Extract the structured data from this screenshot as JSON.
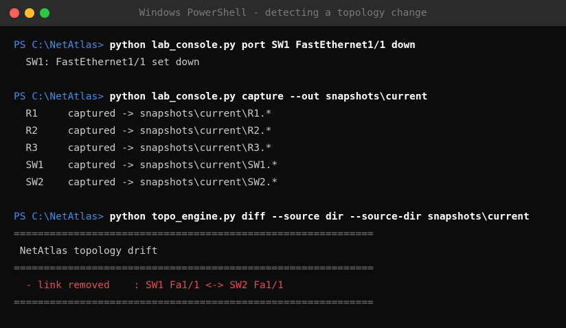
{
  "window": {
    "title": "Windows PowerShell - detecting a topology change",
    "controls": {
      "close_color": "#ff5f57",
      "minimize_color": "#febc2e",
      "maximize_color": "#28c840"
    }
  },
  "terminal": {
    "prompt": "PS C:\\NetAtlas>",
    "colors": {
      "prompt": "#3b8eea",
      "command": "#ffffff",
      "output": "#cccccc",
      "rule": "#767676",
      "removed": "#e74856"
    },
    "lines": [
      {
        "kind": "command",
        "prompt": "PS C:\\NetAtlas>",
        "text": " python lab_console.py port SW1 FastEthernet1/1 down"
      },
      {
        "kind": "output",
        "text": "  SW1: FastEthernet1/1 set down"
      },
      {
        "kind": "blank",
        "text": ""
      },
      {
        "kind": "command",
        "prompt": "PS C:\\NetAtlas>",
        "text": " python lab_console.py capture --out snapshots\\current"
      },
      {
        "kind": "output",
        "text": "  R1     captured -> snapshots\\current\\R1.*"
      },
      {
        "kind": "output",
        "text": "  R2     captured -> snapshots\\current\\R2.*"
      },
      {
        "kind": "output",
        "text": "  R3     captured -> snapshots\\current\\R3.*"
      },
      {
        "kind": "output",
        "text": "  SW1    captured -> snapshots\\current\\SW1.*"
      },
      {
        "kind": "output",
        "text": "  SW2    captured -> snapshots\\current\\SW2.*"
      },
      {
        "kind": "blank",
        "text": ""
      },
      {
        "kind": "command",
        "prompt": "PS C:\\NetAtlas>",
        "text": " python topo_engine.py diff --source dir --source-dir snapshots\\current"
      },
      {
        "kind": "rule",
        "text": "============================================================"
      },
      {
        "kind": "output",
        "text": " NetAtlas topology drift"
      },
      {
        "kind": "rule",
        "text": "============================================================"
      },
      {
        "kind": "removed",
        "text": "  - link removed    : SW1 Fa1/1 <-> SW2 Fa1/1"
      },
      {
        "kind": "rule",
        "text": "============================================================"
      }
    ]
  }
}
